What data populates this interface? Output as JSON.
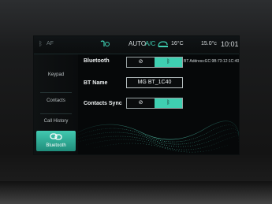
{
  "status_bar": {
    "bt_icon": "bluetooth-icon",
    "af_label": "AF",
    "fan_icon": "fan-icon",
    "auto_label": "AUTO",
    "ac_label": "A/C",
    "recirc_icon": "recirculation-icon",
    "cabin_temp": "16°C",
    "outside_temp": "15.0",
    "outside_temp_unit": "°c",
    "time": "10:01"
  },
  "sidebar": {
    "items": [
      {
        "label": "Keypad",
        "icon": "keypad-icon"
      },
      {
        "label": "Contacts",
        "icon": "contacts-icon"
      },
      {
        "label": "Call History",
        "icon": "call-history-icon"
      },
      {
        "label": "Bluetooth",
        "icon": "link-icon",
        "active": true
      }
    ]
  },
  "settings": {
    "bluetooth": {
      "label": "Bluetooth",
      "off_symbol": "⊘",
      "on_symbol": "ᛒ",
      "state": "on",
      "address": "BT Address:EC:9B:73:12:1C:40"
    },
    "bt_name": {
      "label": "BT Name",
      "value": "MG BT_1C40"
    },
    "contacts_sync": {
      "label": "Contacts Sync",
      "off_symbol": "⊘",
      "on_symbol": "ᛒ",
      "state": "on"
    }
  },
  "colors": {
    "accent": "#3fcfb1",
    "accent_dark": "#1f8d7b",
    "text": "#eef2f3",
    "background": "#060809"
  }
}
